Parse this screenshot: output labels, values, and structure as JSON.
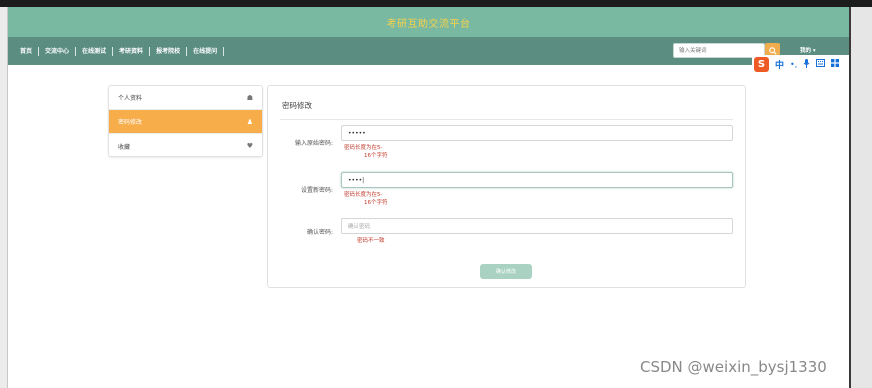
{
  "header": {
    "title": "考研互助交流平台"
  },
  "nav": {
    "items": [
      "首页",
      "交流中心",
      "在线测试",
      "考研资料",
      "报考院校",
      "在线提问"
    ],
    "search_placeholder": "输入关键词",
    "search_icon": "search-icon",
    "user_menu": "我的 ▾"
  },
  "ime": {
    "logo": "S",
    "mode": "中",
    "punct": "•,",
    "icons": [
      "mic-icon",
      "keyboard-icon",
      "grid-icon"
    ]
  },
  "sidebar": {
    "items": [
      {
        "label": "个人资料",
        "icon": "home-icon",
        "glyph": "☗",
        "active": false
      },
      {
        "label": "密码修改",
        "icon": "user-icon",
        "glyph": "♟",
        "active": true
      },
      {
        "label": "收藏",
        "icon": "heart-icon",
        "glyph": "♥",
        "active": false
      }
    ]
  },
  "form": {
    "title": "密码修改",
    "fields": [
      {
        "label": "输入原始密码:",
        "value": "•••••",
        "placeholder": "",
        "error": [
          "密码长度为在5-",
          "16个字符"
        ]
      },
      {
        "label": "设置新密码:",
        "value": "••••|",
        "placeholder": "",
        "error": [
          "密码长度为在5-",
          "16个字符"
        ]
      },
      {
        "label": "确认密码:",
        "value": "",
        "placeholder": "确认密码",
        "error": [
          "密码不一致"
        ]
      }
    ],
    "submit": "确认修改"
  },
  "watermark": "CSDN @weixin_bysj1330",
  "colors": {
    "banner": "#79b8a1",
    "navbar": "#5b8d81",
    "accent": "#f6ad4a",
    "error": "#c0392b",
    "title": "#f7d34a"
  }
}
